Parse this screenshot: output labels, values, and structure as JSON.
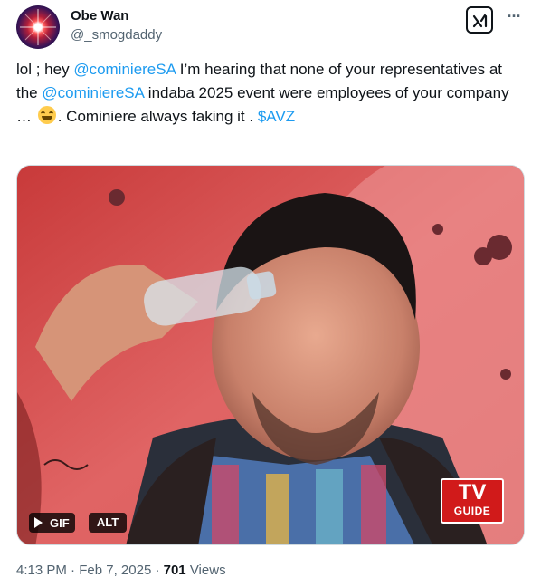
{
  "author": {
    "display_name": "Obe Wan",
    "handle": "@_smogdaddy",
    "avatar_icon": "avatar-image"
  },
  "actions": {
    "grok_icon": "grok-icon",
    "more_label": "···"
  },
  "tweet": {
    "t1": "lol ; hey ",
    "m1": "@cominiereSA",
    "t2": " I’m hearing that none of your representatives at the ",
    "m2": "@cominiereSA",
    "t3": " indaba 2025 event were employees of your company … ",
    "emoji_icon": "grinning-squinting-face-emoji",
    "t4": ". Cominiere always faking it . ",
    "cashtag": "$AVZ"
  },
  "media": {
    "gif_label": "GIF",
    "alt_label": "ALT",
    "watermark_line1": "TV",
    "watermark_line2": "GUIDE"
  },
  "meta": {
    "time": "4:13 PM",
    "sep1": " · ",
    "date": "Feb 7, 2025",
    "sep2": " · ",
    "views_count": "701",
    "views_label": " Views"
  },
  "colors": {
    "link": "#1d9bf0",
    "secondary_text": "#536471",
    "primary_text": "#0f1419"
  }
}
